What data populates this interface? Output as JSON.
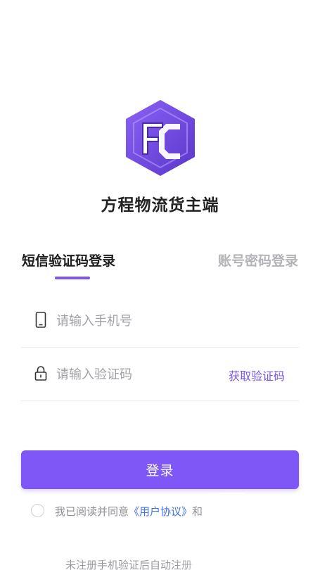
{
  "app": {
    "title": "方程物流货主端",
    "logo_letters": "FC"
  },
  "tabs": [
    {
      "label": "短信验证码登录",
      "active": true
    },
    {
      "label": "账号密码登录",
      "active": false
    }
  ],
  "form": {
    "phone": {
      "value": "",
      "placeholder": "请输入手机号",
      "icon": "phone-icon"
    },
    "code": {
      "value": "",
      "placeholder": "请输入验证码",
      "icon": "lock-icon",
      "action_label": "获取验证码"
    }
  },
  "login_button": {
    "label": "登录"
  },
  "agreement": {
    "checked": false,
    "prefix": "我已阅读并同意",
    "link1": "《用户协议》",
    "suffix": "和"
  },
  "footer_note": "未注册手机验证后自动注册",
  "colors": {
    "accent": "#7f57f7",
    "link": "#3d73e6",
    "inactive_tab": "#b3b3b8"
  }
}
